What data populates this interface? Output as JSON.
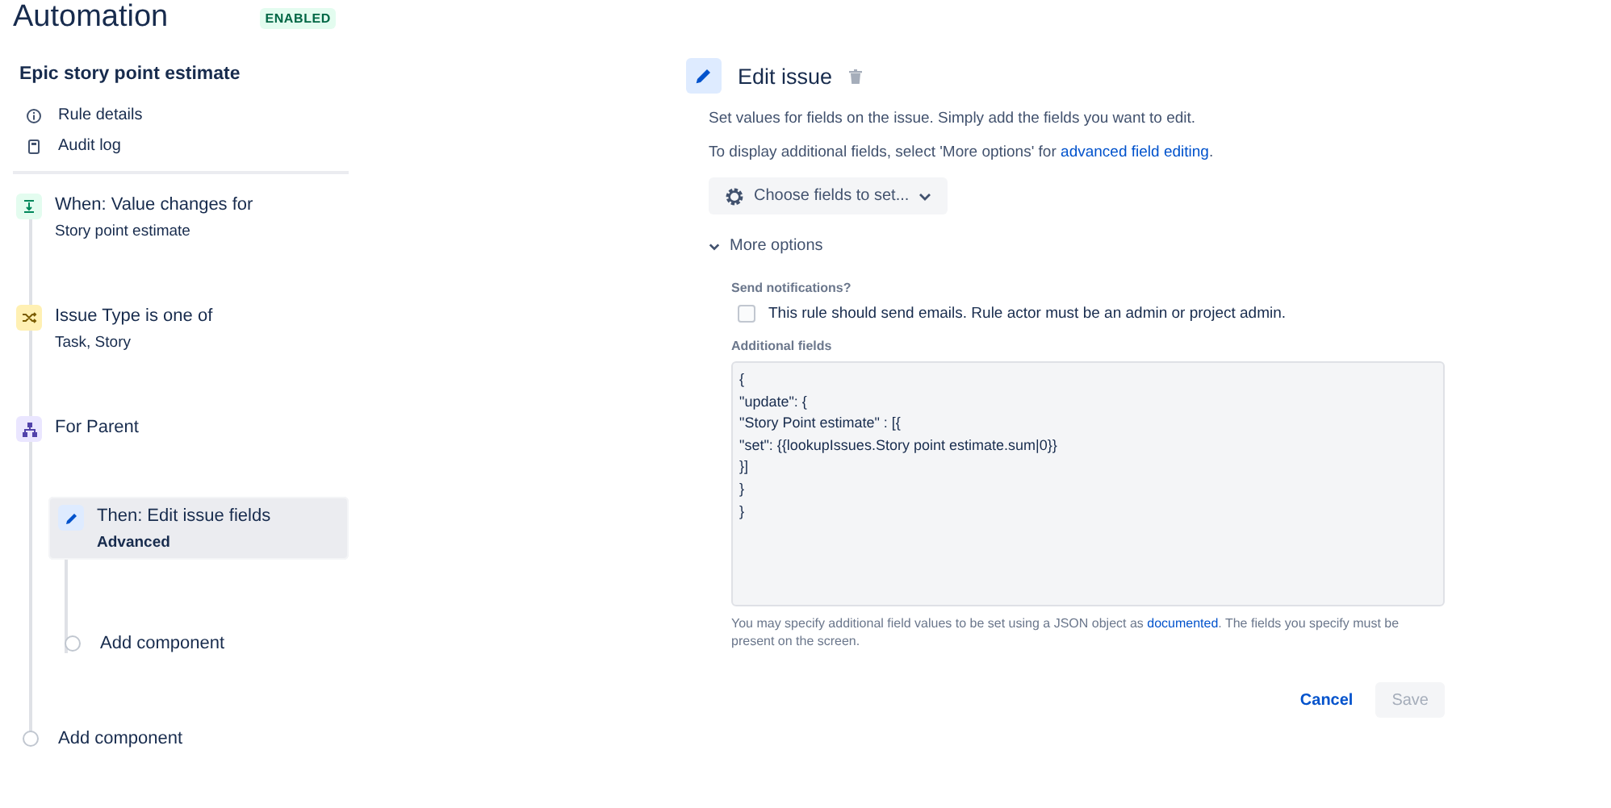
{
  "header": {
    "title": "Automation",
    "status": "ENABLED"
  },
  "rule": {
    "name": "Epic story point estimate",
    "nav": [
      {
        "label": "Rule details",
        "kind": "info"
      },
      {
        "label": "Audit log",
        "kind": "log"
      }
    ]
  },
  "components": [
    {
      "kind": "trigger",
      "title": "When: Value changes for",
      "detail": "Story point estimate",
      "selected": false
    },
    {
      "kind": "condition",
      "title": "Issue Type is one of",
      "detail": "Task, Story",
      "selected": false
    },
    {
      "kind": "branch",
      "title": "For Parent",
      "selected": false,
      "children": [
        {
          "kind": "action",
          "title": "Then: Edit issue fields",
          "detail": "Advanced",
          "selected": true
        },
        {
          "kind": "add",
          "title": "Add component",
          "selected": false
        }
      ]
    },
    {
      "kind": "add",
      "title": "Add component",
      "selected": false
    }
  ],
  "editor": {
    "title": "Edit issue",
    "description": "Set values for fields on the issue. Simply add the fields you want to edit.",
    "more_info": {
      "before": "To display additional fields, select 'More options' for ",
      "link": "advanced field editing",
      "after": "."
    },
    "choose_button": "Choose fields to set...",
    "more_options": {
      "label": "More options",
      "expanded": true
    },
    "notifications": {
      "label": "Send notifications?",
      "checkbox_label": "This rule should send emails. Rule actor must be an admin or project admin.",
      "checked": false
    },
    "additional_fields": {
      "label": "Additional fields",
      "value": "{\n\"update\": {\n\"Story Point estimate\" : [{\n\"set\": {{lookupIssues.Story point estimate.sum|0}}\n}]\n}\n}"
    },
    "help": {
      "before": "You may specify additional field values to be set using a JSON object as ",
      "link": "documented",
      "after": ". The fields you specify must be present on the screen."
    },
    "actions": {
      "cancel": "Cancel",
      "save": "Save",
      "save_disabled": true
    }
  }
}
